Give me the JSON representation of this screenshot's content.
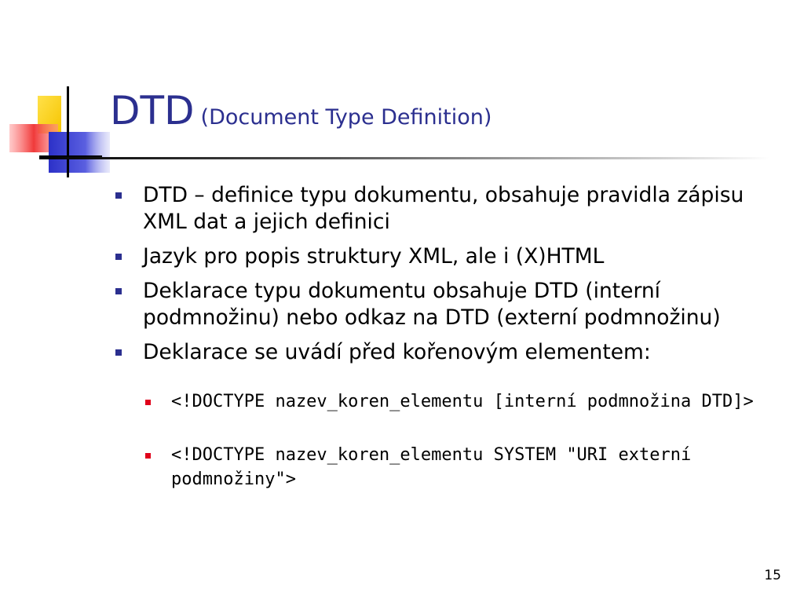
{
  "slide": {
    "title": "DTD",
    "subtitle": "(Document Type Definition)",
    "bullets": [
      "DTD – definice typu dokumentu, obsahuje pravidla zápisu XML dat a jejich definici",
      "Jazyk pro popis struktury XML, ale i (X)HTML",
      "Deklarace typu dokumentu obsahuje DTD (interní podmnožinu) nebo odkaz na DTD (externí podmnožinu)",
      "Deklarace se uvádí před kořenovým elementem:"
    ],
    "sub_bullets": [
      "<!DOCTYPE nazev_koren_elementu [interní podmnožina DTD]>",
      "<!DOCTYPE nazev_koren_elementu SYSTEM \"URI externí podmnožiny\">"
    ],
    "page_number": "15"
  },
  "colors": {
    "title": "#2b2f8f",
    "bullet_level1": "#2b2f8f",
    "bullet_level2": "#e0001b",
    "logo_yellow": "#ffd21f",
    "logo_red": "#f24a4a",
    "logo_blue": "#2c31c8"
  }
}
